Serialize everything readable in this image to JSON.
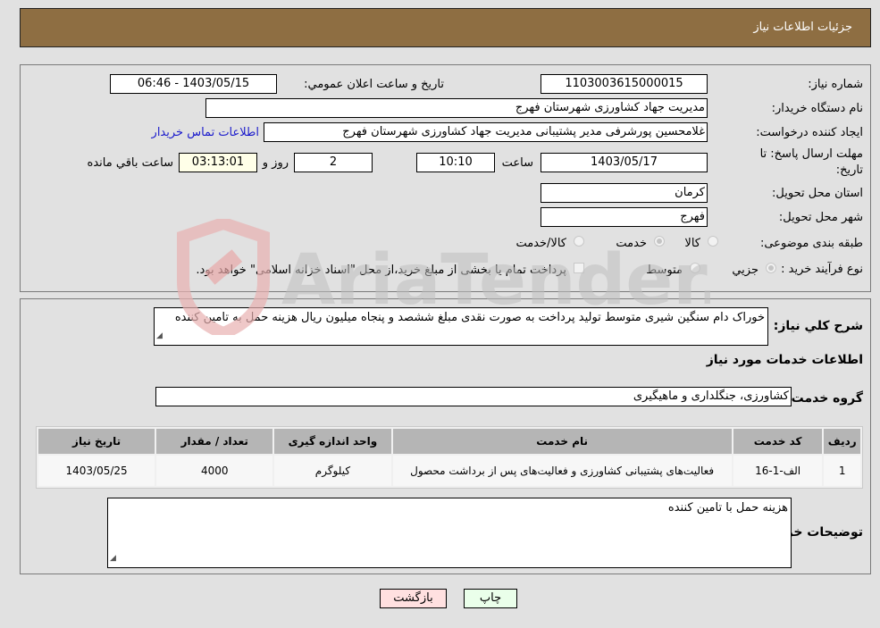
{
  "header": {
    "title": "جزئیات اطلاعات نیاز"
  },
  "form": {
    "need_number": {
      "label": "شماره نیاز:",
      "value": "1103003615000015"
    },
    "announce_datetime": {
      "label": "تاریخ و ساعت اعلان عمومي:",
      "value": "1403/05/15 - 06:46"
    },
    "buyer_org": {
      "label": "نام دستگاه خريدار:",
      "value": "مدیریت جهاد کشاورزی شهرستان فهرج"
    },
    "requester": {
      "label": "ایجاد کننده درخواست:",
      "value": "غلامحسین پورشرفی مدیر پشتیبانی مدیریت جهاد کشاورزی شهرستان فهرج"
    },
    "contact_link": "اطلاعات تماس خریدار",
    "deadline": {
      "label_line1": "مهلت ارسال پاسخ: تا",
      "label_line2": "تاریخ:",
      "date": "1403/05/17",
      "time_label": "ساعت",
      "time": "10:10",
      "days": "2",
      "days_label": "روز و",
      "remaining": "03:13:01",
      "remaining_label": "ساعت باقي مانده"
    },
    "province": {
      "label": "استان محل تحویل:",
      "value": "کرمان"
    },
    "city": {
      "label": "شهر محل تحویل:",
      "value": "فهرج"
    },
    "category": {
      "label": "طبقه بندی موضوعی:",
      "options": [
        {
          "label": "کالا",
          "selected": false
        },
        {
          "label": "خدمت",
          "selected": true
        },
        {
          "label": "کالا/خدمت",
          "selected": false
        }
      ]
    },
    "purchase_type": {
      "label": "نوع فرآیند خرید :",
      "options": [
        {
          "label": "جزيي",
          "selected": true
        },
        {
          "label": "متوسط",
          "selected": false
        }
      ],
      "treasury_checkbox_label": "پرداخت تمام یا بخشی از مبلغ خرید،از محل \"اسناد خزانه اسلامی\" خواهد بود.",
      "treasury_checked": false
    }
  },
  "details": {
    "general_desc_label": "شرح کلي نياز:",
    "general_desc": "خوراک دام سنگین شیری متوسط تولید پرداخت به صورت نقدی مبلغ ششصد و پنجاه میلیون ریال هزینه حمل به تامین کننده",
    "services_title": "اطلاعات خدمات مورد نیاز",
    "service_group_label": "گروه خدمت:",
    "service_group": "کشاورزی، جنگلداری و ماهیگیری",
    "table": {
      "headers": [
        "ردیف",
        "کد خدمت",
        "نام خدمت",
        "واحد اندازه گیری",
        "تعداد / مقدار",
        "تاریخ نیاز"
      ],
      "rows": [
        [
          "1",
          "الف-1-16",
          "فعالیت‌های پشتیبانی کشاورزی و فعالیت‌های پس از برداشت محصول",
          "کیلوگرم",
          "4000",
          "1403/05/25"
        ]
      ]
    },
    "buyer_notes_label": "توضیحات خریدار:",
    "buyer_notes": "هزینه حمل با تامین کننده"
  },
  "buttons": {
    "print": "چاپ",
    "back": "بازگشت"
  },
  "colors": {
    "header_bg": "#8e6e42",
    "print_bg": "#eaffea",
    "back_bg": "#ffe0e0",
    "link": "#1a1acc"
  }
}
